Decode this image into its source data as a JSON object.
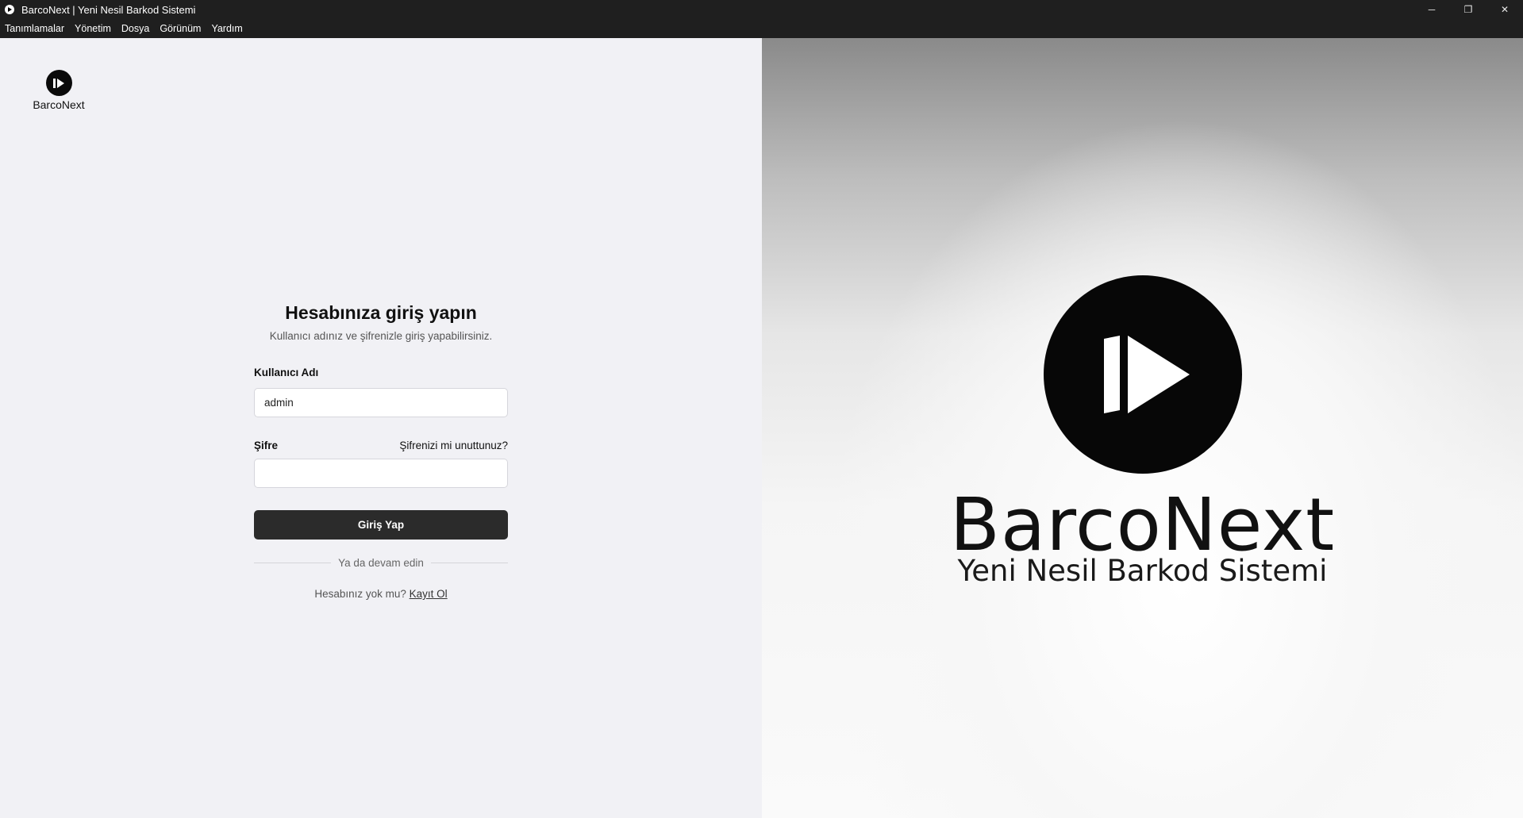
{
  "window": {
    "title": "BarcoNext | Yeni Nesil Barkod Sistemi",
    "controls": {
      "minimize": "─",
      "maximize": "❐",
      "close": "✕"
    }
  },
  "menu": [
    "Tanımlamalar",
    "Yönetim",
    "Dosya",
    "Görünüm",
    "Yardım"
  ],
  "logo": {
    "brand": "BarcoNext",
    "icon": "play-skip-icon"
  },
  "login": {
    "heading": "Hesabınıza giriş yapın",
    "subtitle": "Kullanıcı adınız ve şifrenizle giriş yapabilirsiniz.",
    "username_label": "Kullanıcı Adı",
    "username_value": "admin",
    "password_label": "Şifre",
    "password_value": "",
    "forgot_link": "Şifrenizi mi unuttunuz?",
    "submit": "Giriş Yap",
    "divider": "Ya da devam edin",
    "signup_prompt": "Hesabınız yok mu?",
    "signup_link": "Kayıt Ol"
  },
  "hero": {
    "brand": "BarcoNext",
    "tagline": "Yeni Nesil Barkod Sistemi"
  },
  "colors": {
    "titlebar": "#1f1f1f",
    "left_background": "#f1f1f5",
    "primary_button": "#2b2b2b",
    "logo_disc": "#070707"
  }
}
